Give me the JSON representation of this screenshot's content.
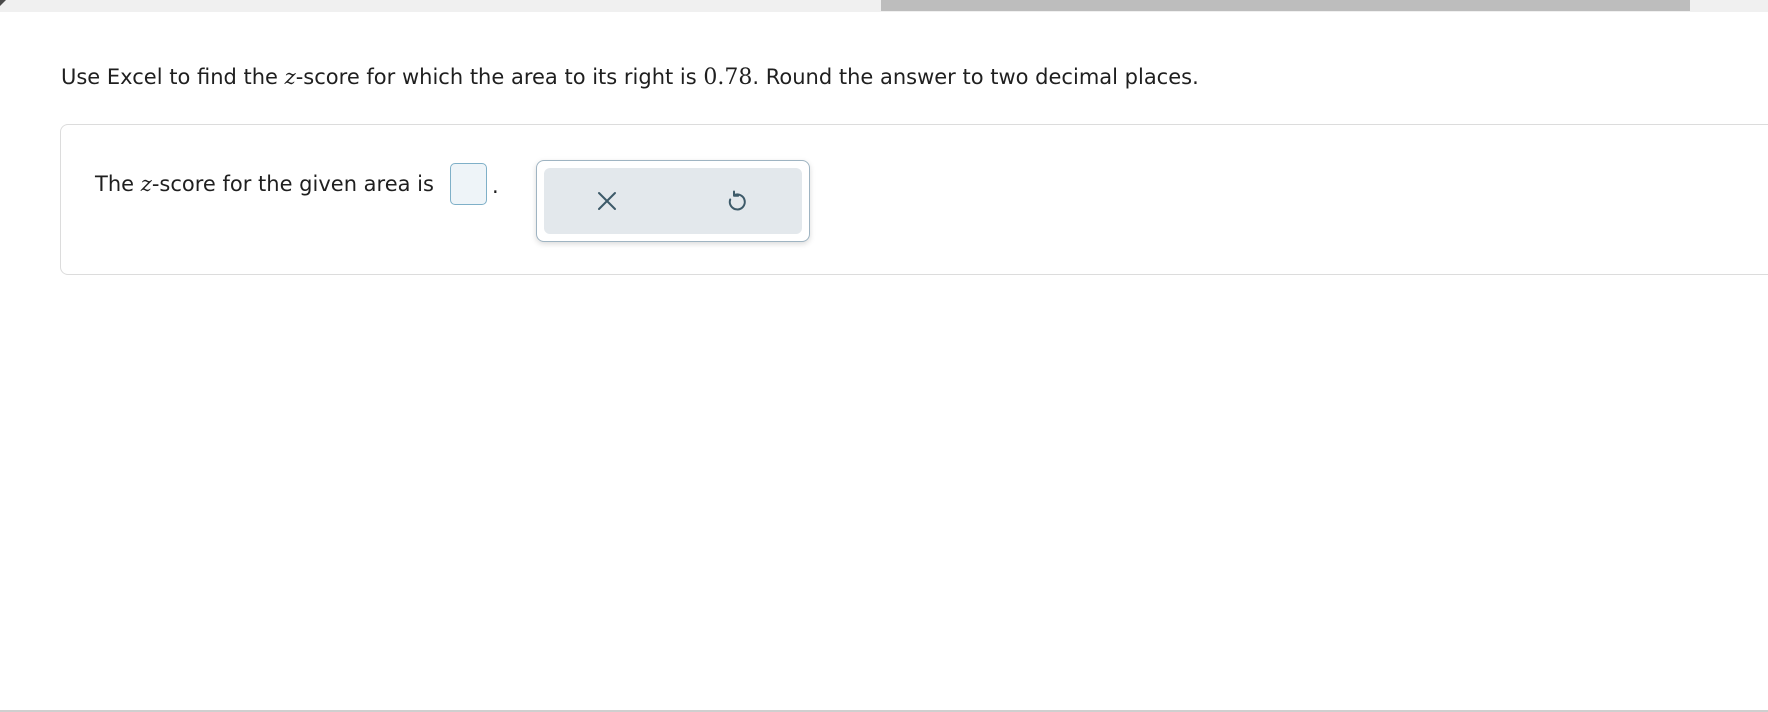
{
  "question": {
    "part1": "Use Excel to find the ",
    "var": "z",
    "part2": "-score for which the area to its right is ",
    "value": "0.78",
    "part3": ". Round the answer to two decimal places."
  },
  "answer": {
    "part1": "The ",
    "var": "z",
    "part2": "-score for the given area is",
    "input_value": "",
    "suffix": "."
  },
  "toolbar": {
    "clear_icon": "close-icon",
    "undo_icon": "undo-icon"
  },
  "colors": {
    "input_border": "#7fb0c8",
    "input_bg": "#eef4f8",
    "toolbar_bg": "#e3e8ec",
    "icon": "#3d5a69"
  }
}
